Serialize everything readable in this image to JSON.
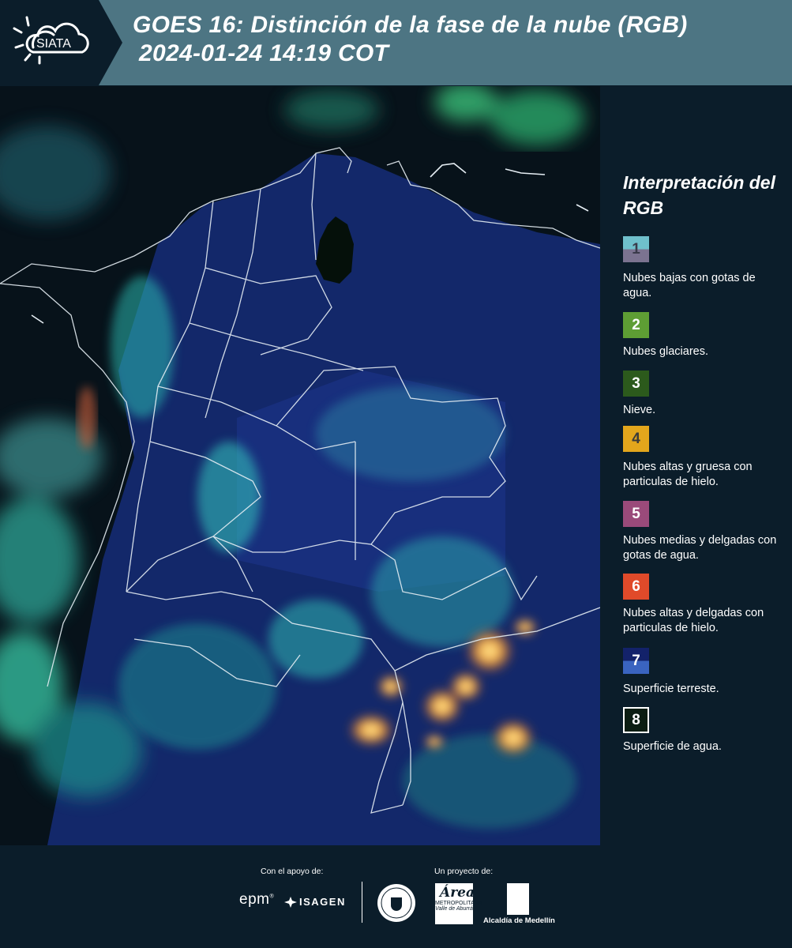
{
  "header": {
    "title_line1": "GOES 16: Distinción de la fase de la nube (RGB)",
    "title_line2": "2024-01-24 14:19 COT",
    "logo_text": "SIATA",
    "background": "#4d7583"
  },
  "legend": {
    "title": "Interpretación del RGB",
    "items": [
      {
        "number": "1",
        "label": "Nubes bajas con gotas de agua.",
        "color_top": "#6fc0cc",
        "color_bottom": "#7b7390",
        "text_color": "#3a3a4a"
      },
      {
        "number": "2",
        "label": "Nubes glaciares.",
        "color_top": "#5e9e34",
        "color_bottom": "#5e9e34",
        "text_color": "#ffffff"
      },
      {
        "number": "3",
        "label": "Nieve.",
        "color_top": "#2c5a1c",
        "color_bottom": "#2c5a1c",
        "text_color": "#ffffff"
      },
      {
        "number": "4",
        "label": "Nubes altas y gruesa con particulas de hielo.",
        "color_top": "#e3a61c",
        "color_bottom": "#e3a61c",
        "text_color": "#3a3a3a"
      },
      {
        "number": "5",
        "label": "Nubes medias y delgadas con gotas de agua.",
        "color_top": "#9a4a7a",
        "color_bottom": "#9a4a7a",
        "text_color": "#ffffff"
      },
      {
        "number": "6",
        "label": "Nubes altas y delgadas con particulas de hielo.",
        "color_top": "#e04a2a",
        "color_bottom": "#e04a2a",
        "text_color": "#ffffff"
      },
      {
        "number": "7",
        "label": "Superficie terreste.",
        "color_top": "#13226a",
        "color_bottom": "#3a64c0",
        "text_color": "#ffffff"
      },
      {
        "number": "8",
        "label": "Superficie de agua.",
        "color_top": "#0b1d12",
        "color_bottom": "#0b1d12",
        "text_color": "#ffffff"
      }
    ]
  },
  "footer": {
    "support_label": "Con el apoyo de:",
    "project_label": "Un proyecto de:",
    "sponsor_1": "epm",
    "sponsor_1_mark": "®",
    "sponsor_2": "ISAGEN",
    "partner_area": "Área",
    "partner_area_sub": "METROPOLITANA",
    "partner_area_sub2": "Valle de Aburrá",
    "partner_alcaldia": "Alcaldía de Medellín"
  }
}
